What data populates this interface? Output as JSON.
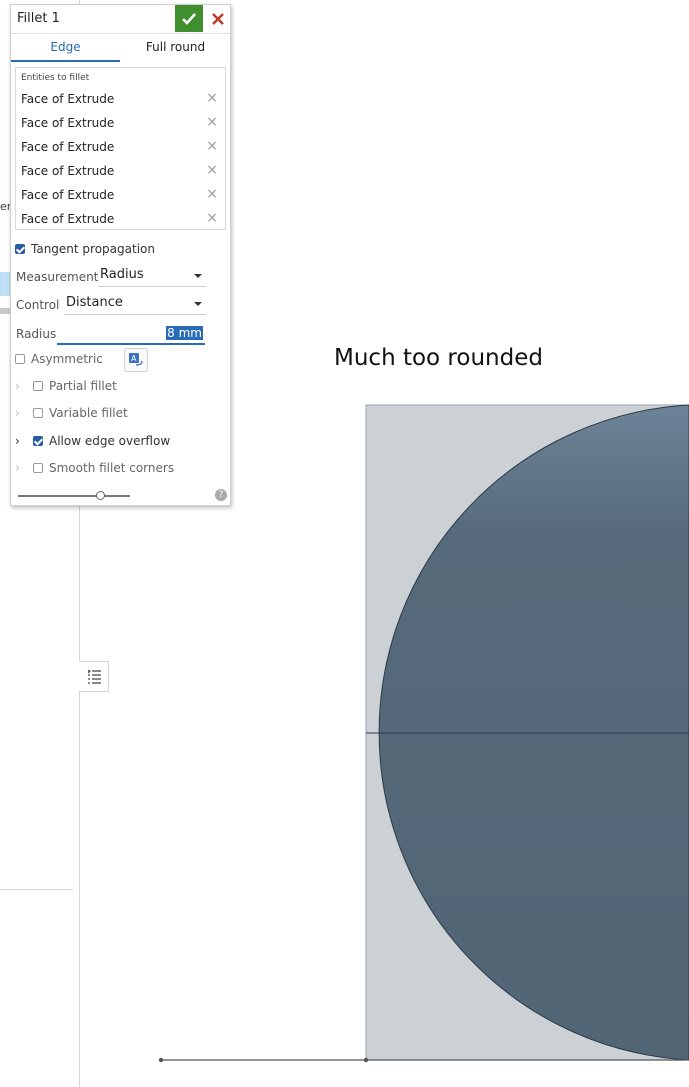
{
  "dialog": {
    "title": "Fillet 1",
    "tabs": [
      "Edge",
      "Full round"
    ],
    "entities_label": "Entities to fillet",
    "entities": [
      "Face of Extrude",
      "Face of Extrude",
      "Face of Extrude",
      "Face of Extrude",
      "Face of Extrude",
      "Face of Extrude"
    ],
    "tangent_propagation": "Tangent propagation",
    "measurement_label": "Measurement",
    "measurement_value": "Radius",
    "control_label": "Control",
    "control_value": "Distance",
    "radius_label": "Radius",
    "radius_value": "8 mm",
    "asymmetric": "Asymmetric",
    "partial_fillet": "Partial fillet",
    "variable_fillet": "Variable fillet",
    "allow_edge_overflow": "Allow edge overflow",
    "smooth_fillet_corners": "Smooth fillet corners",
    "help": "?"
  },
  "left_panel": {
    "partial_text": "er"
  },
  "viewport": {
    "annotation": "Much too rounded"
  },
  "colors": {
    "accent": "#2a6bb8",
    "accept": "#3f8f2f",
    "part_face": "#536676",
    "part_back": "#ccd1d5"
  }
}
